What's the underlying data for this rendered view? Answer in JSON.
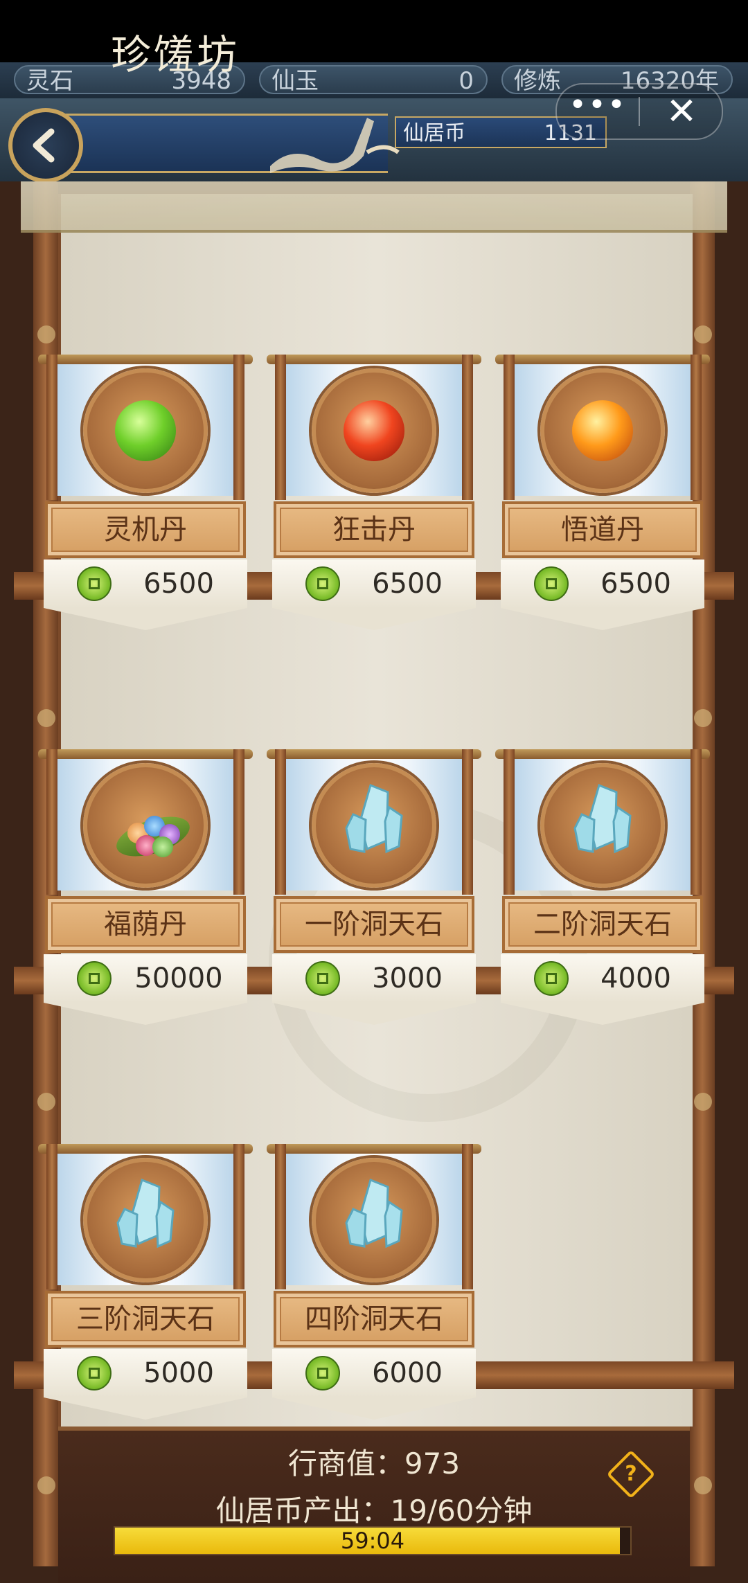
{
  "resources": [
    {
      "label": "灵石",
      "value": "3948"
    },
    {
      "label": "仙玉",
      "value": "0"
    },
    {
      "label": "修炼",
      "value": "16320年"
    }
  ],
  "header": {
    "title": "珍馐坊",
    "currency_label": "仙居币",
    "currency_value": "1131",
    "more_label": "•••",
    "close_label": "✕"
  },
  "items": [
    {
      "name": "灵机丹",
      "price": "6500",
      "icon": "green-pill-icon"
    },
    {
      "name": "狂击丹",
      "price": "6500",
      "icon": "red-pill-icon"
    },
    {
      "name": "悟道丹",
      "price": "6500",
      "icon": "orange-pill-icon"
    },
    {
      "name": "福荫丹",
      "price": "50000",
      "icon": "berries-on-leaf-icon"
    },
    {
      "name": "一阶洞天石",
      "price": "3000",
      "icon": "crystal-icon"
    },
    {
      "name": "二阶洞天石",
      "price": "4000",
      "icon": "crystal-icon"
    },
    {
      "name": "三阶洞天石",
      "price": "5000",
      "icon": "crystal-icon"
    },
    {
      "name": "四阶洞天石",
      "price": "6000",
      "icon": "crystal-icon"
    }
  ],
  "footer": {
    "merchant_value_text": "行商值：973",
    "output_text": "仙居币产出：19/60分钟",
    "timer": "59:04",
    "progress_fraction": 0.98,
    "help_label": "?"
  },
  "colors": {
    "accent_gold": "#c9a35c",
    "progress_yellow": "#f2c21a",
    "wood_brown": "#7b4a2a"
  }
}
